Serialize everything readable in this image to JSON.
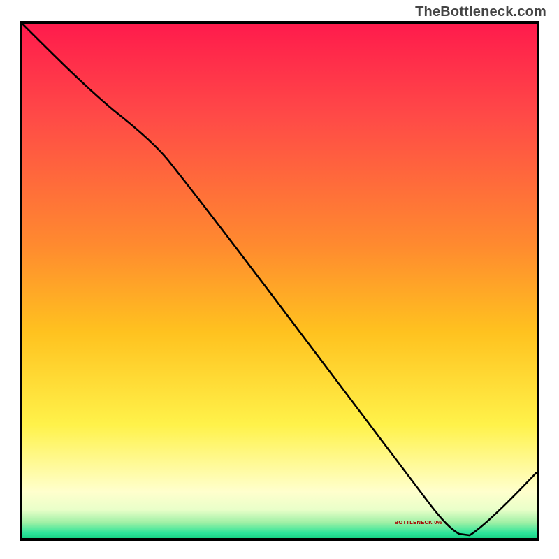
{
  "watermark": "TheBottleneck.com",
  "bottom_label": "BOTTLENECK 0%",
  "chart_data": {
    "type": "line",
    "title": "",
    "xlabel": "",
    "ylabel": "",
    "xlim": [
      0,
      100
    ],
    "ylim": [
      0,
      100
    ],
    "grid": false,
    "series": [
      {
        "name": "curve",
        "x": [
          0,
          6,
          12,
          18,
          24,
          30,
          36,
          42,
          48,
          54,
          60,
          66,
          72,
          78,
          82,
          85,
          90,
          95,
          100
        ],
        "y": [
          100,
          94,
          88,
          83,
          78,
          71,
          61,
          52,
          43,
          35,
          27,
          19,
          11,
          4,
          1,
          0,
          5,
          10,
          15
        ]
      }
    ],
    "background_gradient_stops": [
      {
        "pct": 0,
        "color": "#ff1b4c"
      },
      {
        "pct": 18,
        "color": "#ff4a47"
      },
      {
        "pct": 43,
        "color": "#ff8a2f"
      },
      {
        "pct": 60,
        "color": "#ffc21f"
      },
      {
        "pct": 78,
        "color": "#fff24a"
      },
      {
        "pct": 91,
        "color": "#ffffcd"
      },
      {
        "pct": 95,
        "color": "#e9ffc9"
      },
      {
        "pct": 97,
        "color": "#9ff0a5"
      },
      {
        "pct": 99,
        "color": "#2ee59b"
      },
      {
        "pct": 100,
        "color": "#18d386"
      }
    ],
    "valley_x_pct": 85
  }
}
